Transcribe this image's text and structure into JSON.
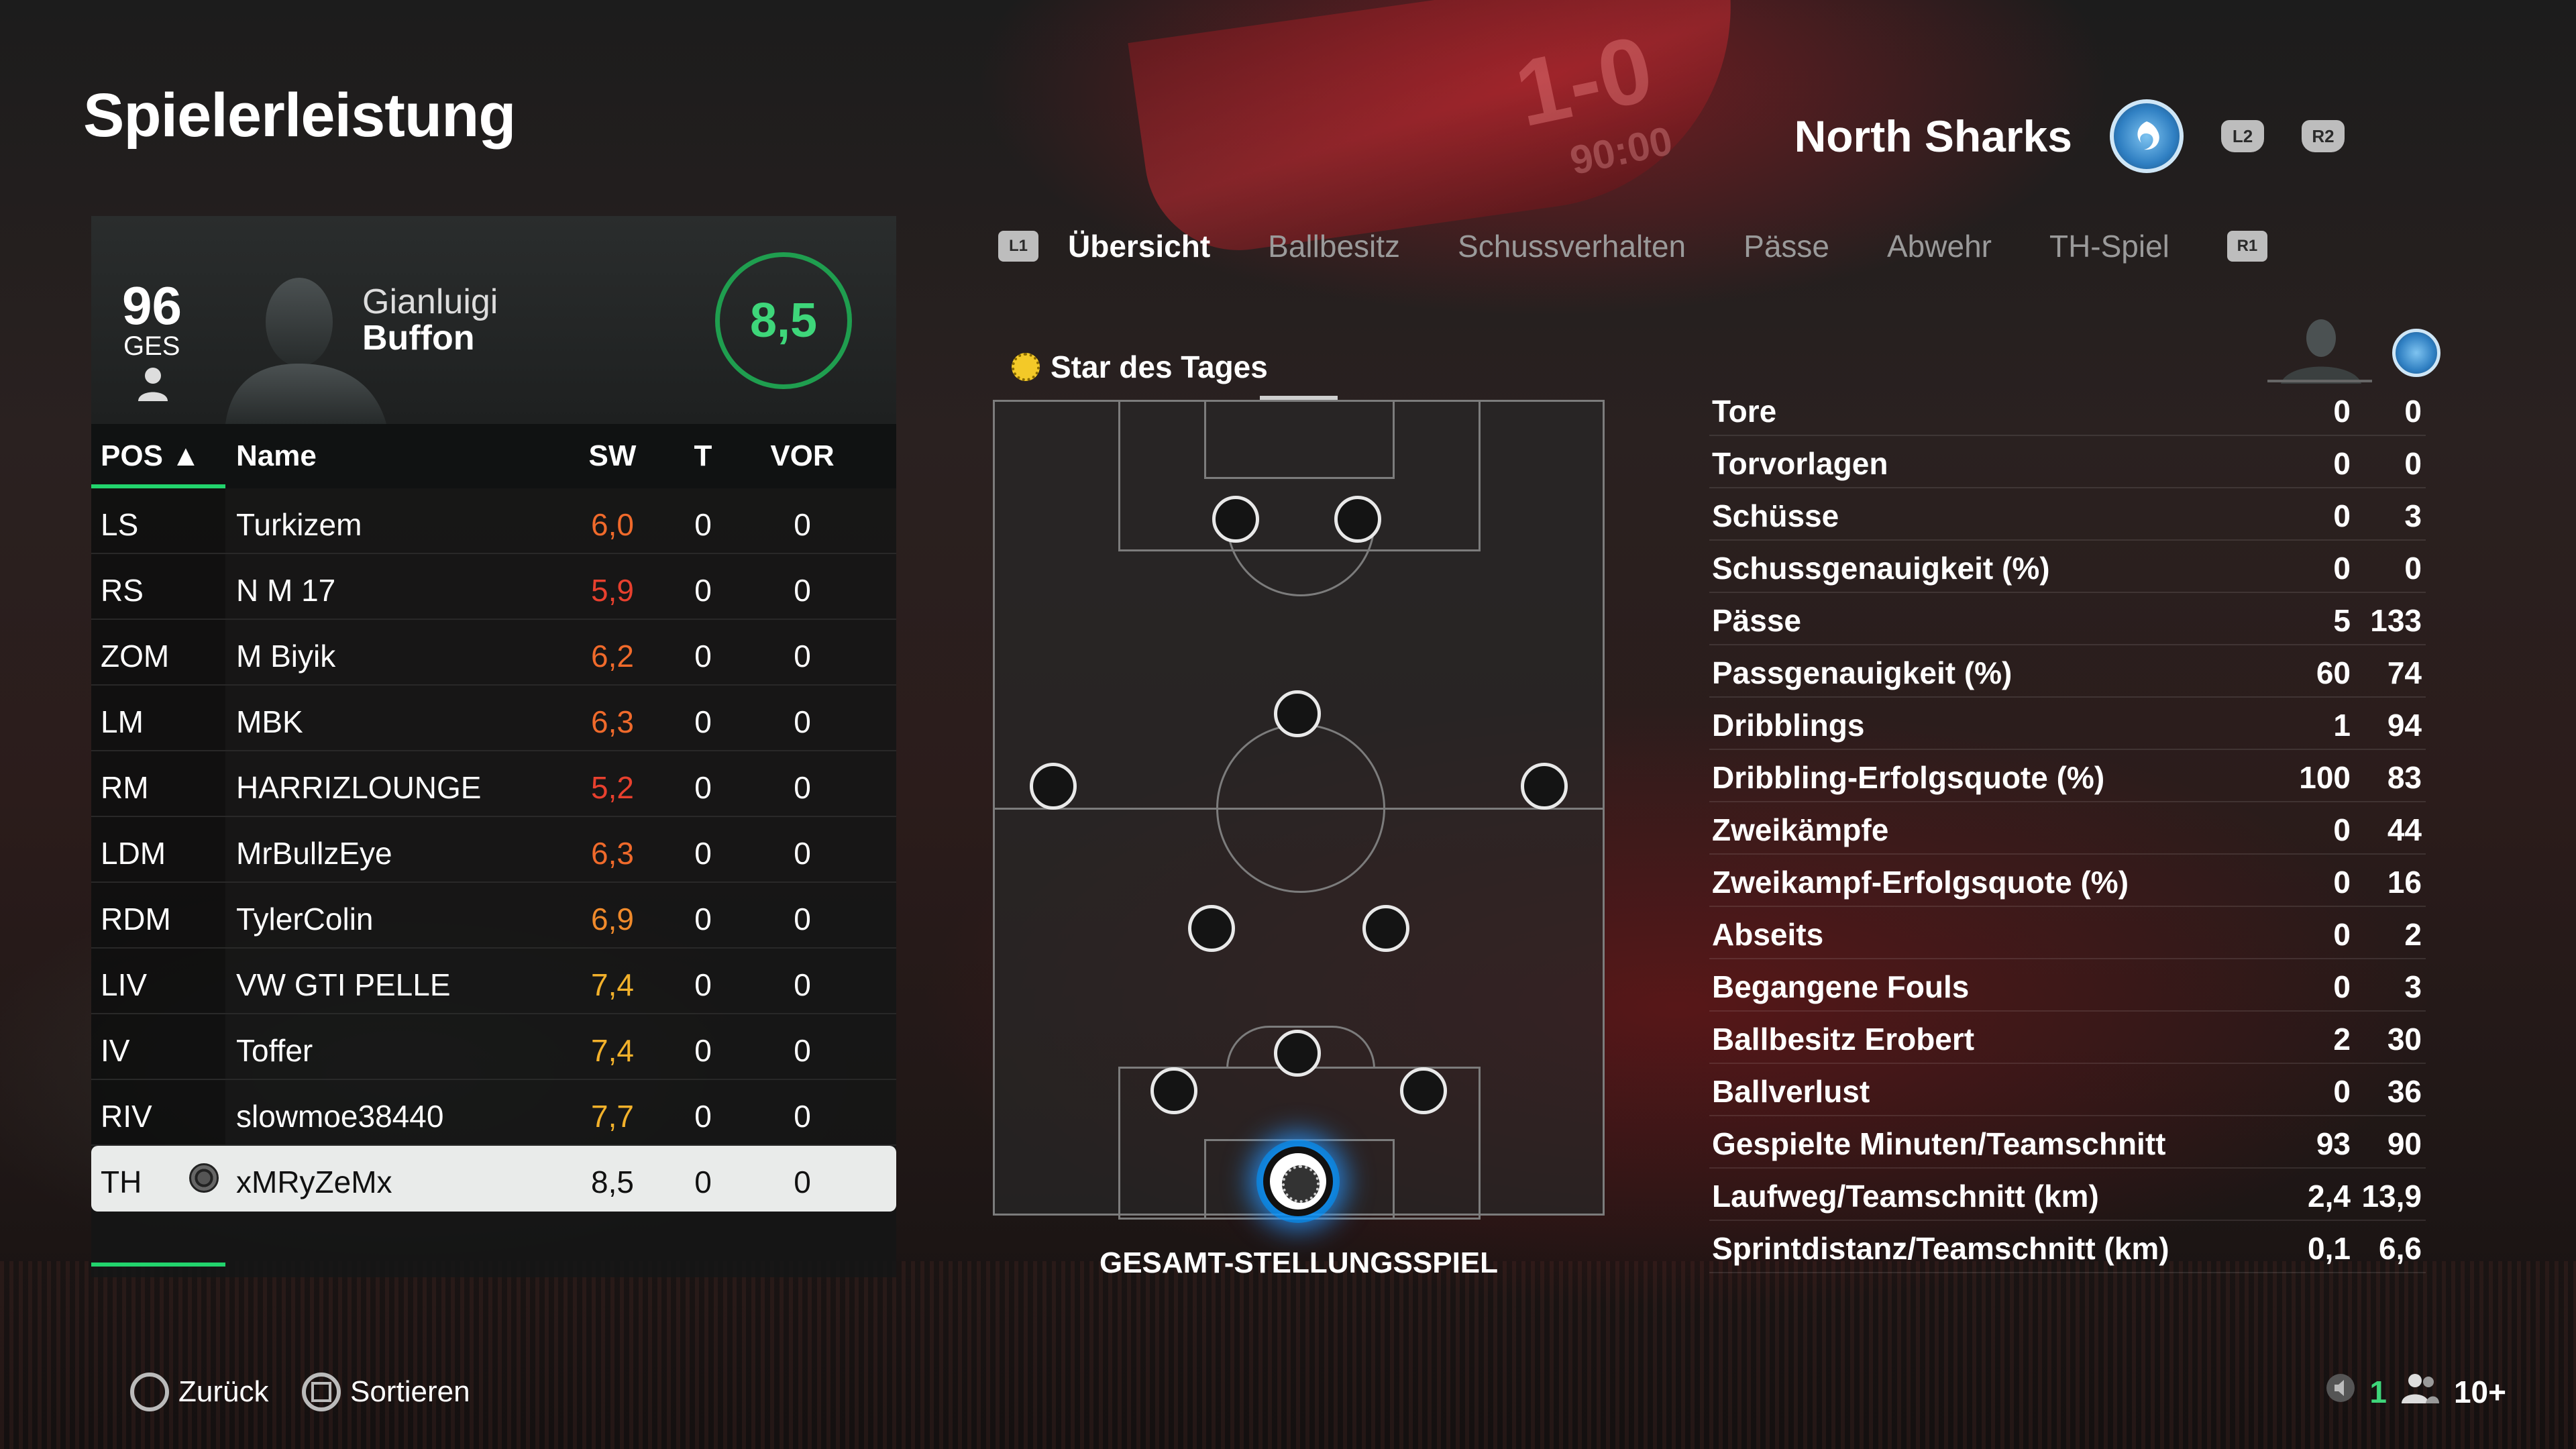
{
  "page": {
    "title": "Spielerleistung"
  },
  "team": {
    "name": "North Sharks",
    "l2": "L2",
    "r2": "R2",
    "crest_icon": "shark-crest-icon"
  },
  "background": {
    "score": "1-0",
    "time": "90:00"
  },
  "player": {
    "ovr": "96",
    "ovr_label": "GES",
    "first_name": "Gianluigi",
    "last_name": "Buffon",
    "rating": "8,5"
  },
  "table": {
    "headers": {
      "pos": "POS ▲",
      "name": "Name",
      "sw": "SW",
      "t": "T",
      "vor": "VOR"
    },
    "rows": [
      {
        "pos": "LS",
        "name": "Turkizem",
        "sw": "6,0",
        "t": "0",
        "vor": "0",
        "color": "#f06a2b"
      },
      {
        "pos": "RS",
        "name": "N M 17",
        "sw": "5,9",
        "t": "0",
        "vor": "0",
        "color": "#e8402e"
      },
      {
        "pos": "ZOM",
        "name": "M Biyik",
        "sw": "6,2",
        "t": "0",
        "vor": "0",
        "color": "#f06a2b"
      },
      {
        "pos": "LM",
        "name": "MBK",
        "sw": "6,3",
        "t": "0",
        "vor": "0",
        "color": "#f06a2b"
      },
      {
        "pos": "RM",
        "name": "HARRIZLOUNGE",
        "sw": "5,2",
        "t": "0",
        "vor": "0",
        "color": "#e8402e"
      },
      {
        "pos": "LDM",
        "name": "MrBullzEye",
        "sw": "6,3",
        "t": "0",
        "vor": "0",
        "color": "#f06a2b"
      },
      {
        "pos": "RDM",
        "name": "TylerColin",
        "sw": "6,9",
        "t": "0",
        "vor": "0",
        "color": "#f08a2b"
      },
      {
        "pos": "LIV",
        "name": "VW GTI PELLE",
        "sw": "7,4",
        "t": "0",
        "vor": "0",
        "color": "#f2b12b"
      },
      {
        "pos": "IV",
        "name": "Toffer",
        "sw": "7,4",
        "t": "0",
        "vor": "0",
        "color": "#f2b12b"
      },
      {
        "pos": "RIV",
        "name": "slowmoe38440",
        "sw": "7,7",
        "t": "0",
        "vor": "0",
        "color": "#f2b12b"
      },
      {
        "pos": "TH",
        "name": "xMRyZeMx",
        "sw": "8,5",
        "t": "0",
        "vor": "0",
        "color": "#111111"
      }
    ]
  },
  "tabs": {
    "l1": "L1",
    "r1": "R1",
    "items": [
      "Übersicht",
      "Ballbesitz",
      "Schussverhalten",
      "Pässe",
      "Abwehr",
      "TH-Spiel"
    ]
  },
  "star": {
    "label": "Star des Tages"
  },
  "pitch": {
    "caption": "GESAMT-STELLUNGSSPIEL"
  },
  "stats": [
    {
      "label": "Tore",
      "a": "0",
      "b": "0"
    },
    {
      "label": "Torvorlagen",
      "a": "0",
      "b": "0"
    },
    {
      "label": "Schüsse",
      "a": "0",
      "b": "3"
    },
    {
      "label": "Schussgenauigkeit (%)",
      "a": "0",
      "b": "0"
    },
    {
      "label": "Pässe",
      "a": "5",
      "b": "133"
    },
    {
      "label": "Passgenauigkeit (%)",
      "a": "60",
      "b": "74"
    },
    {
      "label": "Dribblings",
      "a": "1",
      "b": "94"
    },
    {
      "label": "Dribbling-Erfolgsquote (%)",
      "a": "100",
      "b": "83"
    },
    {
      "label": "Zweikämpfe",
      "a": "0",
      "b": "44"
    },
    {
      "label": "Zweikampf-Erfolgsquote (%)",
      "a": "0",
      "b": "16"
    },
    {
      "label": "Abseits",
      "a": "0",
      "b": "2"
    },
    {
      "label": "Begangene Fouls",
      "a": "0",
      "b": "3"
    },
    {
      "label": "Ballbesitz Erobert",
      "a": "2",
      "b": "30"
    },
    {
      "label": "Ballverlust",
      "a": "0",
      "b": "36"
    },
    {
      "label": "Gespielte Minuten/Teamschnitt",
      "a": "93",
      "b": "90"
    },
    {
      "label": "Laufweg/Teamschnitt (km)",
      "a": "2,4",
      "b": "13,9"
    },
    {
      "label": "Sprintdistanz/Teamschnitt (km)",
      "a": "0,1",
      "b": "6,6"
    }
  ],
  "footer": {
    "back": "Zurück",
    "sort": "Sortieren",
    "voice_count": "1",
    "party": "10+"
  }
}
